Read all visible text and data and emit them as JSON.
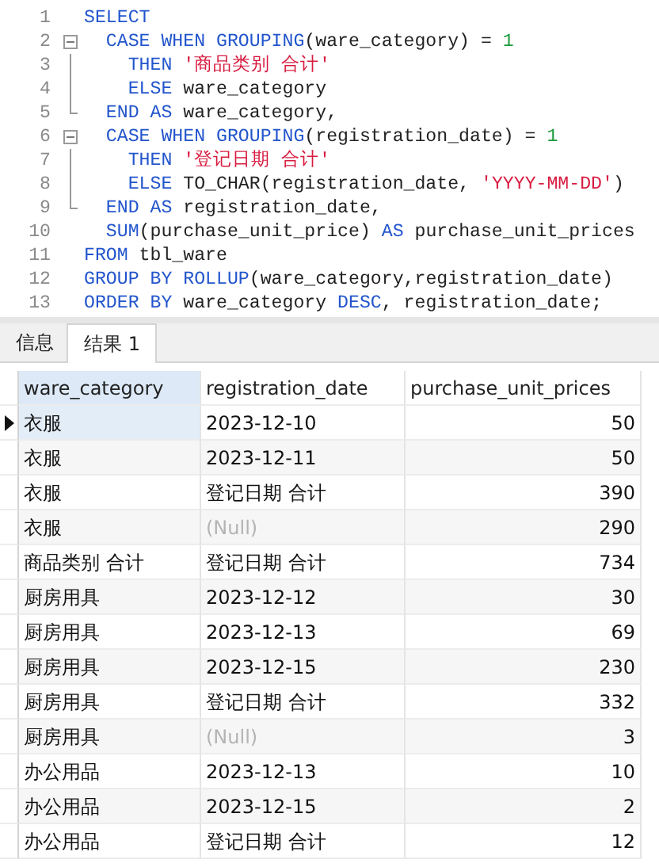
{
  "editor": {
    "lines": [
      {
        "number": "1",
        "kind": "plain",
        "tokens": [
          {
            "t": "SELECT",
            "kind": "keyword"
          }
        ]
      },
      {
        "number": "2",
        "kind": "open",
        "tokens": [
          {
            "t": "  CASE WHEN GROUPING",
            "kind": "keyword"
          },
          {
            "t": "(ware_category) = ",
            "kind": "plain"
          },
          {
            "t": "1",
            "kind": "number"
          }
        ]
      },
      {
        "number": "3",
        "kind": "body",
        "tokens": [
          {
            "t": "    THEN ",
            "kind": "keyword"
          },
          {
            "t": "'商品类别 合计'",
            "kind": "string"
          }
        ]
      },
      {
        "number": "4",
        "kind": "body",
        "tokens": [
          {
            "t": "    ELSE ",
            "kind": "keyword"
          },
          {
            "t": "ware_category",
            "kind": "plain"
          }
        ]
      },
      {
        "number": "5",
        "kind": "end",
        "tokens": [
          {
            "t": "  END AS ",
            "kind": "keyword"
          },
          {
            "t": "ware_category,",
            "kind": "plain"
          }
        ]
      },
      {
        "number": "6",
        "kind": "open",
        "tokens": [
          {
            "t": "  CASE WHEN GROUPING",
            "kind": "keyword"
          },
          {
            "t": "(registration_date) = ",
            "kind": "plain"
          },
          {
            "t": "1",
            "kind": "number"
          }
        ]
      },
      {
        "number": "7",
        "kind": "body",
        "tokens": [
          {
            "t": "    THEN ",
            "kind": "keyword"
          },
          {
            "t": "'登记日期 合计'",
            "kind": "string"
          }
        ]
      },
      {
        "number": "8",
        "kind": "body",
        "tokens": [
          {
            "t": "    ELSE ",
            "kind": "keyword"
          },
          {
            "t": "TO_CHAR(registration_date, ",
            "kind": "plain"
          },
          {
            "t": "'YYYY-MM-DD'",
            "kind": "string"
          },
          {
            "t": ")",
            "kind": "plain"
          }
        ]
      },
      {
        "number": "9",
        "kind": "end",
        "tokens": [
          {
            "t": "  END AS ",
            "kind": "keyword"
          },
          {
            "t": "registration_date,",
            "kind": "plain"
          }
        ]
      },
      {
        "number": "10",
        "kind": "plain",
        "tokens": [
          {
            "t": "  SUM",
            "kind": "keyword"
          },
          {
            "t": "(purchase_unit_price) ",
            "kind": "plain"
          },
          {
            "t": "AS ",
            "kind": "keyword"
          },
          {
            "t": "purchase_unit_prices",
            "kind": "plain"
          }
        ]
      },
      {
        "number": "11",
        "kind": "plain",
        "tokens": [
          {
            "t": "FROM ",
            "kind": "keyword"
          },
          {
            "t": "tbl_ware",
            "kind": "plain"
          }
        ]
      },
      {
        "number": "12",
        "kind": "plain",
        "tokens": [
          {
            "t": "GROUP BY ROLLUP",
            "kind": "keyword"
          },
          {
            "t": "(ware_category,registration_date)",
            "kind": "plain"
          }
        ]
      },
      {
        "number": "13",
        "kind": "plain",
        "tokens": [
          {
            "t": "ORDER BY ",
            "kind": "keyword"
          },
          {
            "t": "ware_category ",
            "kind": "plain"
          },
          {
            "t": "DESC",
            "kind": "keyword"
          },
          {
            "t": ", registration_date;",
            "kind": "plain"
          }
        ]
      }
    ]
  },
  "tabs": [
    {
      "label": "信息",
      "selected": false
    },
    {
      "label": "结果 1",
      "selected": true
    }
  ],
  "table": {
    "columns": [
      "ware_category",
      "registration_date",
      "purchase_unit_prices"
    ],
    "rows": [
      {
        "selected": true,
        "cells": [
          "衣服",
          "2023-12-10",
          "50"
        ],
        "date_null": false
      },
      {
        "selected": false,
        "cells": [
          "衣服",
          "2023-12-11",
          "50"
        ],
        "date_null": false
      },
      {
        "selected": false,
        "cells": [
          "衣服",
          "登记日期 合计",
          "390"
        ],
        "date_null": false
      },
      {
        "selected": false,
        "cells": [
          "衣服",
          "(Null)",
          "290"
        ],
        "date_null": true
      },
      {
        "selected": false,
        "cells": [
          "商品类别 合计",
          "登记日期 合计",
          "734"
        ],
        "date_null": false
      },
      {
        "selected": false,
        "cells": [
          "厨房用具",
          "2023-12-12",
          "30"
        ],
        "date_null": false
      },
      {
        "selected": false,
        "cells": [
          "厨房用具",
          "2023-12-13",
          "69"
        ],
        "date_null": false
      },
      {
        "selected": false,
        "cells": [
          "厨房用具",
          "2023-12-15",
          "230"
        ],
        "date_null": false
      },
      {
        "selected": false,
        "cells": [
          "厨房用具",
          "登记日期 合计",
          "332"
        ],
        "date_null": false
      },
      {
        "selected": false,
        "cells": [
          "厨房用具",
          "(Null)",
          "3"
        ],
        "date_null": true
      },
      {
        "selected": false,
        "cells": [
          "办公用品",
          "2023-12-13",
          "10"
        ],
        "date_null": false
      },
      {
        "selected": false,
        "cells": [
          "办公用品",
          "2023-12-15",
          "2"
        ],
        "date_null": false
      },
      {
        "selected": false,
        "cells": [
          "办公用品",
          "登记日期 合计",
          "12"
        ],
        "date_null": false
      }
    ]
  }
}
